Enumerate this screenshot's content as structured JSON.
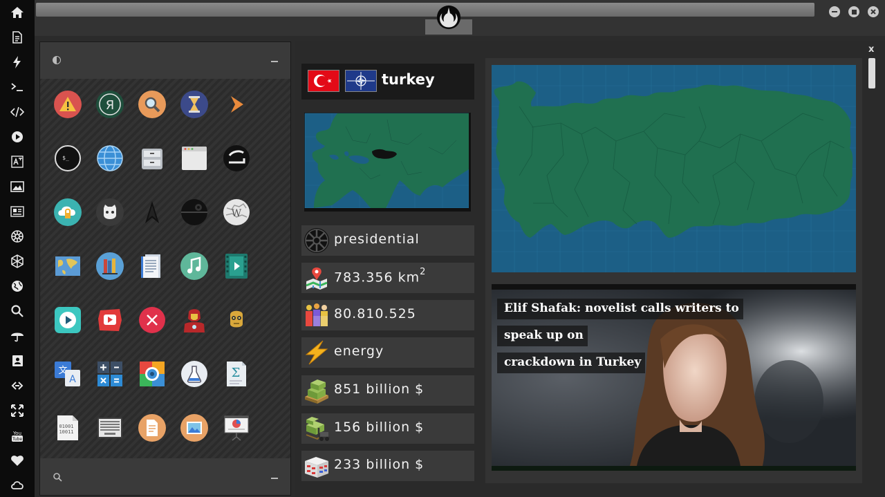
{
  "dock": {
    "items": [
      "home-icon",
      "document-icon",
      "lightning-icon",
      "terminal-icon",
      "code-icon",
      "play-icon",
      "translate-icon",
      "image-icon",
      "newspaper-icon",
      "galactic-empire-icon",
      "hexagon-icon",
      "globe-icon",
      "search-icon",
      "umbrella-icon",
      "contacts-icon",
      "link-icon",
      "fullscreen-icon",
      "youtube-icon",
      "heart-icon",
      "cloud-icon"
    ]
  },
  "apps": {
    "header_icon": "contrast-icon",
    "footer_icon": "search-icon",
    "grid": [
      [
        "warning-icon",
        "yandex-icon",
        "search-magnifier-icon",
        "hourglass-icon",
        "chevron-right-icon"
      ],
      [
        "terminal-icon",
        "globe-icon",
        "file-cabinet-icon",
        "window-icon",
        "bracket-icon"
      ],
      [
        "cloud-lock-icon",
        "github-icon",
        "starfleet-icon",
        "death-star-icon",
        "wikipedia-icon"
      ],
      [
        "world-map-icon",
        "books-icon",
        "document-stack-icon",
        "music-note-icon",
        "video-film-icon"
      ],
      [
        "play-circle-icon",
        "youtube-icon",
        "close-circle-icon",
        "iron-man-icon",
        "c3po-icon"
      ],
      [
        "translate-icon",
        "calculator-icon",
        "photo-viewer-icon",
        "lab-flask-icon",
        "formula-icon"
      ],
      [
        "binary-file-icon",
        "keyboard-icon",
        "text-file-icon",
        "image-file-icon",
        "presentation-icon"
      ]
    ]
  },
  "country": {
    "name": "turkey",
    "government": "presidential",
    "area": "783.356",
    "area_unit": "km",
    "area_sup": "2",
    "population": "80.810.525",
    "resource": "energy",
    "gdp": "851 billion $",
    "imports": "156 billion $",
    "exports": "233 billion $"
  },
  "news": {
    "headline_line1": "Elif Shafak: novelist calls writers to speak up on",
    "headline_line2": "crackdown in Turkey"
  },
  "window": {
    "close_label": "x"
  },
  "colors": {
    "map_water": "#1c5f86",
    "map_land": "#207050",
    "flag_red": "#e30a17",
    "nato_blue": "#1f3a8a"
  }
}
